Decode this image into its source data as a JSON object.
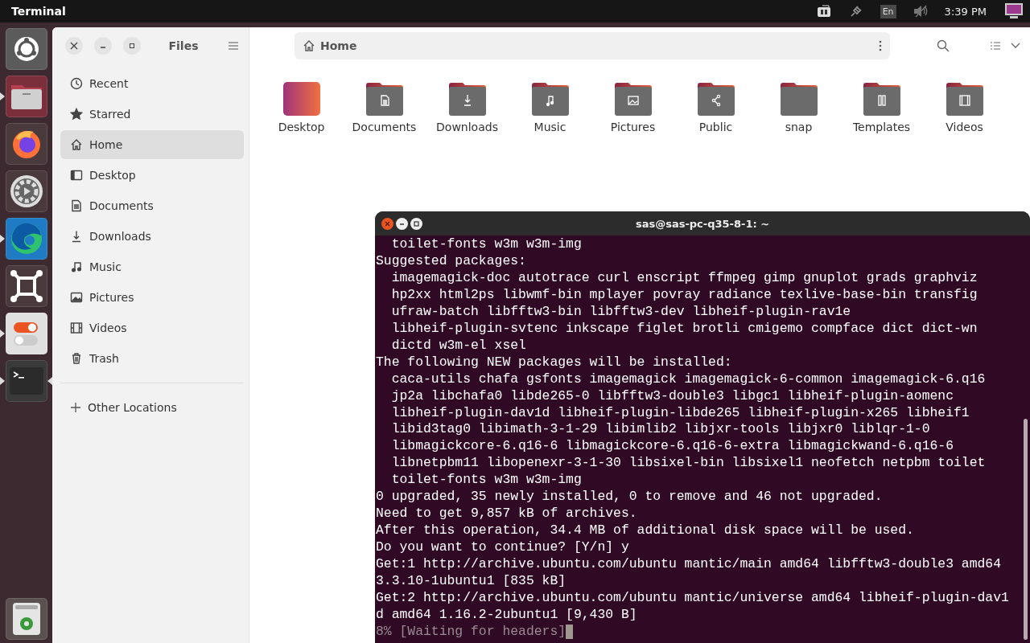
{
  "top_bar": {
    "app_title": "Terminal",
    "keyboard_layout": "En",
    "clock": "3:39 PM"
  },
  "launcher": {
    "items": [
      {
        "kind": "ubuntu",
        "running": false,
        "focused": false
      },
      {
        "kind": "files",
        "running": true,
        "focused": false
      },
      {
        "kind": "firefox",
        "running": false,
        "focused": false
      },
      {
        "kind": "settings",
        "running": false,
        "focused": false
      },
      {
        "kind": "edge",
        "running": true,
        "focused": false
      },
      {
        "kind": "frame",
        "running": false,
        "focused": false
      },
      {
        "kind": "toggles",
        "running": true,
        "focused": false
      },
      {
        "kind": "terminal",
        "running": true,
        "focused": true
      }
    ],
    "trash": {
      "kind": "trash"
    }
  },
  "files_window": {
    "title": "Files",
    "path": "Home",
    "sidebar": {
      "items": [
        {
          "kind": "recent",
          "label": "Recent",
          "selected": false
        },
        {
          "kind": "starred",
          "label": "Starred",
          "selected": false
        },
        {
          "kind": "home",
          "label": "Home",
          "selected": true
        },
        {
          "kind": "desktop",
          "label": "Desktop",
          "selected": false
        },
        {
          "kind": "documents",
          "label": "Documents",
          "selected": false
        },
        {
          "kind": "downloads",
          "label": "Downloads",
          "selected": false
        },
        {
          "kind": "music",
          "label": "Music",
          "selected": false
        },
        {
          "kind": "pictures",
          "label": "Pictures",
          "selected": false
        },
        {
          "kind": "videos",
          "label": "Videos",
          "selected": false
        },
        {
          "kind": "trash",
          "label": "Trash",
          "selected": false
        }
      ],
      "other_locations": "Other Locations"
    },
    "folders": [
      {
        "kind": "desktop",
        "label": "Desktop"
      },
      {
        "kind": "documents",
        "label": "Documents"
      },
      {
        "kind": "downloads",
        "label": "Downloads"
      },
      {
        "kind": "music",
        "label": "Music"
      },
      {
        "kind": "pictures",
        "label": "Pictures"
      },
      {
        "kind": "public",
        "label": "Public"
      },
      {
        "kind": "plain",
        "label": "snap"
      },
      {
        "kind": "templates",
        "label": "Templates"
      },
      {
        "kind": "videos",
        "label": "Videos"
      }
    ]
  },
  "terminal": {
    "title": "sas@sas-pc-q35-8-1: ~",
    "lines": [
      "  toilet-fonts w3m w3m-img",
      "Suggested packages:",
      "  imagemagick-doc autotrace curl enscript ffmpeg gimp gnuplot grads graphviz",
      "  hp2xx html2ps libwmf-bin mplayer povray radiance texlive-base-bin transfig",
      "  ufraw-batch libfftw3-bin libfftw3-dev libheif-plugin-rav1e",
      "  libheif-plugin-svtenc inkscape figlet brotli cmigemo compface dict dict-wn",
      "  dictd w3m-el xsel",
      "The following NEW packages will be installed:",
      "  caca-utils chafa gsfonts imagemagick imagemagick-6-common imagemagick-6.q16",
      "  jp2a libchafa0 libde265-0 libfftw3-double3 libgc1 libheif-plugin-aomenc",
      "  libheif-plugin-dav1d libheif-plugin-libde265 libheif-plugin-x265 libheif1",
      "  libid3tag0 libimath-3-1-29 libimlib2 libjxr-tools libjxr0 liblqr-1-0",
      "  libmagickcore-6.q16-6 libmagickcore-6.q16-6-extra libmagickwand-6.q16-6",
      "  libnetpbm11 libopenexr-3-1-30 libsixel-bin libsixel1 neofetch netpbm toilet",
      "  toilet-fonts w3m w3m-img",
      "0 upgraded, 35 newly installed, 0 to remove and 46 not upgraded.",
      "Need to get 9,857 kB of archives.",
      "After this operation, 34.4 MB of additional disk space will be used.",
      "Do you want to continue? [Y/n] y",
      "Get:1 http://archive.ubuntu.com/ubuntu mantic/main amd64 libfftw3-double3 amd64",
      "3.3.10-1ubuntu1 [835 kB]",
      "Get:2 http://archive.ubuntu.com/ubuntu mantic/universe amd64 libheif-plugin-dav1",
      "d amd64 1.16.2-2ubuntu1 [9,430 B]"
    ],
    "status_line": "8% [Waiting for headers]"
  }
}
